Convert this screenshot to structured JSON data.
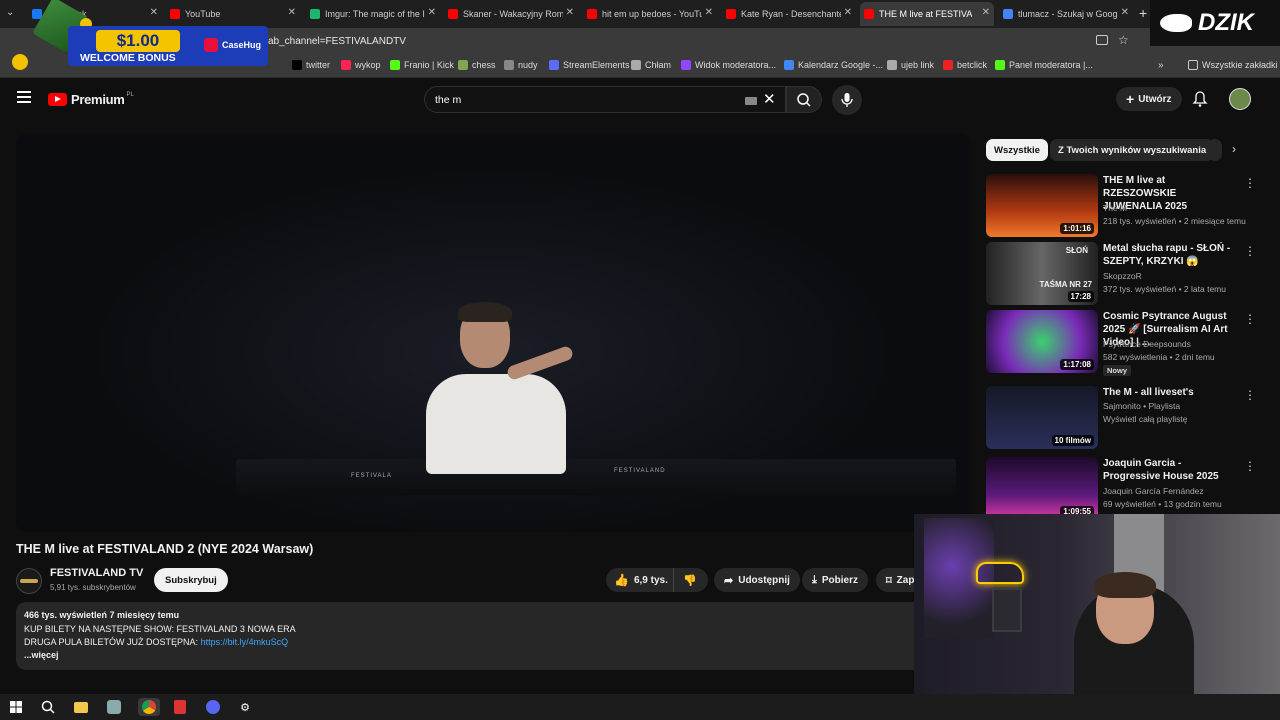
{
  "tabs": [
    {
      "label": "Facebook",
      "color": "#1877f2"
    },
    {
      "label": "YouTube",
      "color": "#ff0000"
    },
    {
      "label": "Imgur: The magic of the I",
      "color": "#1bb76e"
    },
    {
      "label": "Skaner - Wakacyjny Roma",
      "color": "#ff0000"
    },
    {
      "label": "hit em up bedoes - YouTu",
      "color": "#ff0000"
    },
    {
      "label": "Kate Ryan - Desenchante",
      "color": "#ff0000"
    },
    {
      "label": "THE M live at FESTIVA",
      "color": "#ff0000",
      "active": true
    },
    {
      "label": "tlumacz - Szukaj w Googl",
      "color": "#4285f4"
    }
  ],
  "address": {
    "url": "ab_channel=FESTIVALANDTV"
  },
  "bookmarks": [
    {
      "label": "twitter",
      "icon": "x-icon"
    },
    {
      "label": "wykop",
      "icon": "wykop-icon"
    },
    {
      "label": "Franio | Kick",
      "icon": "kick-icon"
    },
    {
      "label": "chess",
      "icon": "pawn-icon"
    },
    {
      "label": "nudy",
      "icon": "folder-icon"
    },
    {
      "label": "StreamElements",
      "icon": "streamelements-icon"
    },
    {
      "label": "Chłam",
      "icon": "globe-icon"
    },
    {
      "label": "Widok moderatora...",
      "icon": "twitch-icon"
    },
    {
      "label": "Kalendarz Google -...",
      "icon": "calendar-icon"
    },
    {
      "label": "ujeb link",
      "icon": "link-icon"
    },
    {
      "label": "betclick",
      "icon": "betclick-icon"
    },
    {
      "label": "Panel moderatora |...",
      "icon": "kick-icon"
    }
  ],
  "bookmarks_all": "Wszystkie zakładki",
  "ad": {
    "amount": "$1.00",
    "bonus": "WELCOME BONUS",
    "brand": "CaseHug"
  },
  "brand_overlay": "DZIK",
  "youtube": {
    "logo": "Premium",
    "logo_sup": "PL",
    "search_value": "the m",
    "create_label": "Utwórz",
    "chips": [
      "Wszystkie",
      "Z Twoich wyników wyszukiwania"
    ],
    "video": {
      "title": "THE M live at FESTIVALAND 2 (NYE 2024 Warsaw)",
      "channel": "FESTIVALAND TV",
      "subscribers": "5,91 tys. subskrybentów",
      "subscribe": "Subskrybuj",
      "likes": "6,9 tys.",
      "share": "Udostępnij",
      "download": "Pobierz",
      "save": "Zap",
      "desc_stats": "466 tys. wyświetleń  7 miesięcy temu",
      "desc_line1": "KUP BILETY NA NASTĘPNE SHOW: FESTIVALAND 3 NOWA ERA",
      "desc_line2": "DRUGA PULA BILETÓW JUŻ DOSTĘPNA:",
      "desc_link": "https://bit.ly/4mkuScQ",
      "more": "...więcej",
      "stage_text_left": "FESTIVALA",
      "stage_text_right": "FESTIVALAND"
    },
    "recommendations": [
      {
        "title": "THE M live at RZESZOWSKIE JUWENALIA 2025",
        "channel": "The M",
        "meta": "218 tys. wyświetleń • 2 miesiące temu",
        "duration": "1:01:16"
      },
      {
        "title": "Metal słucha rapu - SŁOŃ - SZEPTY, KRZYKI 😱",
        "channel": "SkopzzoR",
        "meta": "372 tys. wyświetleń • 2 lata temu",
        "duration": "17:28",
        "thumb_text1": "SŁOŃ",
        "thumb_text2": "TAŚMA NR 27"
      },
      {
        "title": "Cosmic Psytrance August 2025 🚀 [Surrealism AI Art Video] | ...",
        "channel": "Psytrance Deepsounds",
        "meta": "582 wyświetlenia • 2 dni temu",
        "duration": "1:17:08",
        "badge": "Nowy"
      },
      {
        "title": "The M - all liveset's",
        "channel": "Sajmonito • Playlista",
        "meta": "Wyświetl całą playlistę",
        "duration": "10 filmów"
      },
      {
        "title": "Joaquin Garcia - Progressive House 2025",
        "channel": "Joaquin García Fernández",
        "meta": "69 wyświetleń • 13 godzin temu",
        "duration": "1:09:55"
      }
    ]
  },
  "colors": {
    "youtube_red": "#ff0000",
    "bg": "#0f0f0f",
    "chip": "#272727",
    "link": "#3ea6ff"
  }
}
